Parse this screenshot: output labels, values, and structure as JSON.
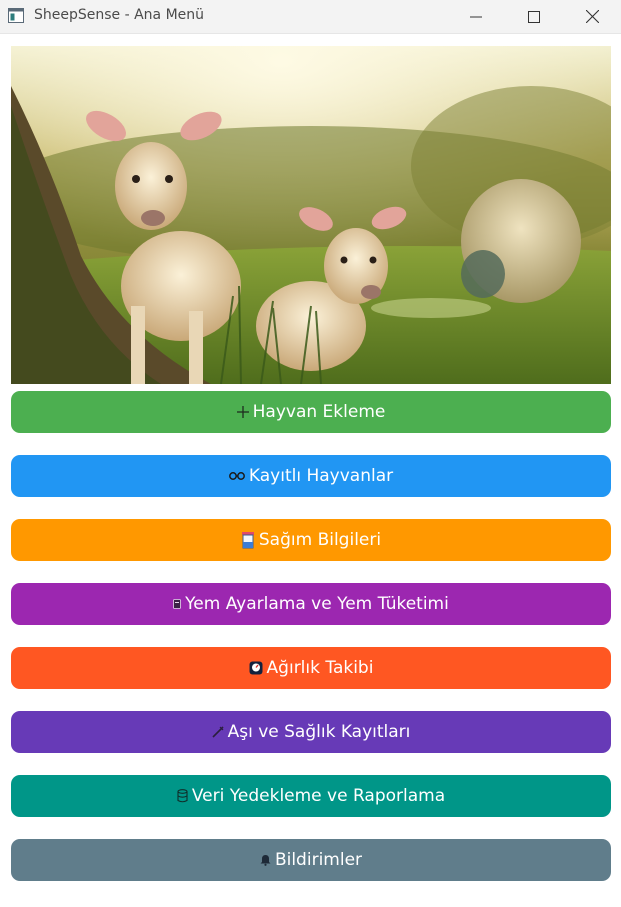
{
  "window": {
    "title": "SheepSense - Ana Menü",
    "minimize_icon": "minimize-icon",
    "maximize_icon": "maximize-icon",
    "close_icon": "close-icon"
  },
  "hero": {
    "icon": "sheep-lambs-photo"
  },
  "menu": {
    "items": [
      {
        "label": "Hayvan Ekleme",
        "icon": "plus-icon",
        "color": "#4caf50"
      },
      {
        "label": "Kayıtlı Hayvanlar",
        "icon": "glasses-icon",
        "color": "#2196f3"
      },
      {
        "label": "Sağım Bilgileri",
        "icon": "milk-jug-icon",
        "color": "#ff9800"
      },
      {
        "label": "Yem Ayarlama ve Yem Tüketimi",
        "icon": "feed-icon",
        "color": "#9c27b0"
      },
      {
        "label": "Ağırlık Takibi",
        "icon": "scale-icon",
        "color": "#ff5722"
      },
      {
        "label": "Aşı ve Sağlık Kayıtları",
        "icon": "syringe-icon",
        "color": "#673ab7"
      },
      {
        "label": "Veri Yedekleme ve Raporlama",
        "icon": "database-icon",
        "color": "#009688"
      },
      {
        "label": "Bildirimler",
        "icon": "bell-icon",
        "color": "#607d8b"
      }
    ]
  }
}
